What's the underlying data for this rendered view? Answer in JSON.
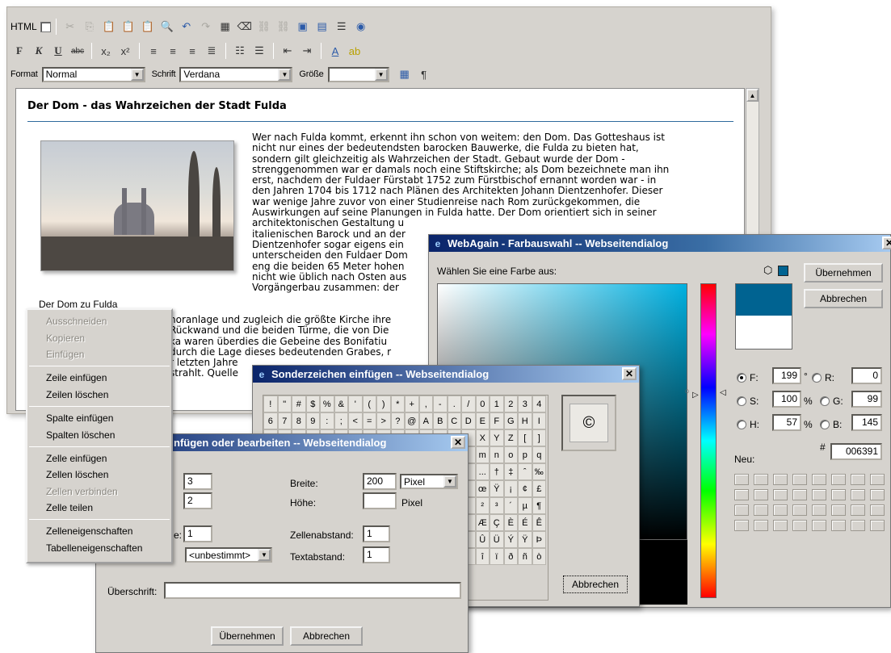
{
  "editor": {
    "toolbar": {
      "html_label": "HTML",
      "format_label": "Format",
      "format_value": "Normal",
      "font_label": "Schrift",
      "font_value": "Verdana",
      "size_label": "Größe",
      "size_value": "",
      "row2_glyphs": [
        "F",
        "K",
        "U",
        "abc",
        "x₂",
        "x²"
      ]
    },
    "doc": {
      "title": "Der Dom - das Wahrzeichen der Stadt Fulda",
      "caption": "Der Dom zu Fulda",
      "text_right": "Wer nach Fulda kommt, erkennt ihn schon von weitem: den Dom. Das Gotteshaus ist\nnicht nur eines der bedeutendsten barocken Bauwerke, die Fulda zu bieten hat,\nsondern gilt gleichzeitig als Wahrzeichen der Stadt. Gebaut wurde der Dom -\nstrenggenommen war er damals noch eine Stiftskirche; als Dom bezeichnete man ihn\nerst, nachdem der Fuldaer Fürstabt 1752 zum Fürstbischof ernannt worden war - in\nden Jahren 1704 bis 1712 nach Plänen des Architekten Johann Dientzenhofer. Dieser\nwar wenige Jahre zuvor von einer Studienreise nach Rom zurückgekommen, die\nAuswirkungen auf seine Planungen in Fulda hatte. Der Dom orientiert sich in seiner\narchitektonischen Gestaltung u\nitalienischen Barock und an der\nDientzenhofer sogar eigens ein\nunterscheiden den Fuldaer Dom\neng die beiden 65 Meter hohen\nnicht wie üblich nach Osten aus\nVorgängerbau zusammen: der",
      "text_lower": "horanlage und zugleich die größte Kirche ihre\nRückwand und die beiden Türme, die von Die\nka waren überdies die Gebeine des Bonifatiu\ndurch die Lage dieses bedeutenden Grabes, r\nr letzten Jahre\nstrahlt. Quelle"
    }
  },
  "context_menu": {
    "groups": [
      [
        {
          "label": "Ausschneiden",
          "enabled": false
        },
        {
          "label": "Kopieren",
          "enabled": false
        },
        {
          "label": "Einfügen",
          "enabled": false
        }
      ],
      [
        {
          "label": "Zeile einfügen",
          "enabled": true
        },
        {
          "label": "Zeilen löschen",
          "enabled": true
        }
      ],
      [
        {
          "label": "Spalte einfügen",
          "enabled": true
        },
        {
          "label": "Spalten löschen",
          "enabled": true
        }
      ],
      [
        {
          "label": "Zelle einfügen",
          "enabled": true
        },
        {
          "label": "Zellen löschen",
          "enabled": true
        },
        {
          "label": "Zellen verbinden",
          "enabled": false
        },
        {
          "label": "Zelle teilen",
          "enabled": true
        }
      ],
      [
        {
          "label": "Zelleneigenschaften",
          "enabled": true
        },
        {
          "label": "Tabelleneigenschaften",
          "enabled": true
        }
      ]
    ]
  },
  "farb_dialog": {
    "title": "WebAgain - Farbauswahl -- Webseitendialog",
    "prompt": "Wählen Sie eine Farbe aus:",
    "ok_button": "Übernehmen",
    "cancel_button": "Abbrechen",
    "current_color": "#006391",
    "new_color": "#ffffff",
    "fields": {
      "F": {
        "label": "F:",
        "value": "199",
        "unit": "°",
        "selected": true
      },
      "S": {
        "label": "S:",
        "value": "100",
        "unit": "%",
        "selected": false
      },
      "H": {
        "label": "H:",
        "value": "57",
        "unit": "%",
        "selected": false
      },
      "R": {
        "label": "R:",
        "value": "0",
        "selected": false
      },
      "G": {
        "label": "G:",
        "value": "99",
        "selected": false
      },
      "B": {
        "label": "B:",
        "value": "145",
        "selected": false
      }
    },
    "hex_label": "#",
    "hex_value": "006391",
    "new_label": "Neu:"
  },
  "sonder_dialog": {
    "title": "Sonderzeichen einfügen -- Webseitendialog",
    "preview_char": "©",
    "cancel_button": "Abbrechen",
    "rows": [
      [
        "!",
        "\"",
        "#",
        "$",
        "%",
        "&",
        "'",
        "(",
        ")",
        "*",
        "+",
        ",",
        "-",
        ".",
        "/",
        "0",
        "1",
        "2",
        "3",
        "4"
      ],
      [
        "6",
        "7",
        "8",
        "9",
        ":",
        ";",
        "<",
        "=",
        ">",
        "?",
        "@",
        "A",
        "B",
        "C",
        "D",
        "E",
        "F",
        "G",
        "H",
        "I"
      ],
      [
        "",
        "",
        "",
        "",
        "",
        "",
        "",
        "",
        "",
        "",
        "",
        "",
        "",
        "",
        "",
        "X",
        "Y",
        "Z",
        "[",
        "]"
      ],
      [
        "",
        "",
        "",
        "",
        "",
        "",
        "",
        "",
        "",
        "",
        "",
        "",
        "",
        "",
        "",
        "m",
        "n",
        "o",
        "p",
        "q"
      ],
      [
        "",
        "",
        "",
        "",
        "",
        "",
        "",
        "",
        "",
        "",
        "",
        "",
        "",
        "",
        "",
        "...",
        "†",
        "‡",
        "ˆ",
        "‰"
      ],
      [
        "",
        "",
        "",
        "",
        "",
        "",
        "",
        "",
        "",
        "",
        "",
        "",
        "",
        "",
        "",
        "œ",
        "Ÿ",
        "¡",
        "¢",
        "£"
      ],
      [
        "",
        "",
        "",
        "",
        "",
        "",
        "",
        "",
        "",
        "",
        "",
        "",
        "",
        "",
        "",
        "²",
        "³",
        "´",
        "µ",
        "¶"
      ],
      [
        "",
        "",
        "",
        "",
        "",
        "",
        "",
        "",
        "",
        "",
        "",
        "",
        "",
        "",
        "",
        "Æ",
        "Ç",
        "È",
        "É",
        "Ê"
      ],
      [
        "",
        "",
        "",
        "",
        "",
        "",
        "",
        "",
        "",
        "",
        "",
        "",
        "",
        "",
        "",
        "Û",
        "Ü",
        "Ý",
        "Ÿ",
        "Þ"
      ],
      [
        "",
        "",
        "",
        "",
        "",
        "",
        "",
        "",
        "",
        "",
        "",
        "",
        "",
        "",
        "",
        "î",
        "ï",
        "ð",
        "ñ",
        "ò"
      ]
    ],
    "extra_row1": [
      "5",
      "5"
    ],
    "extra_row2": [
      "^"
    ]
  },
  "tabelle_dialog": {
    "title": "nfügen oder bearbeiten -- Webseitendialog",
    "rows_value": "3",
    "cols_value": "2",
    "width_label": "Breite:",
    "width_value": "200",
    "width_unit": "Pixel",
    "height_label": "Höhe:",
    "height_value": "",
    "height_unit": "Pixel",
    "border_label": "e:",
    "border_value": "1",
    "align_value": "<unbestimmt>",
    "spacing_label": "Zellenabstand:",
    "spacing_value": "1",
    "padding_label": "Textabstand:",
    "padding_value": "1",
    "caption_label": "Überschrift:",
    "caption_value": "",
    "ok_button": "Übernehmen",
    "cancel_button": "Abbrechen"
  }
}
